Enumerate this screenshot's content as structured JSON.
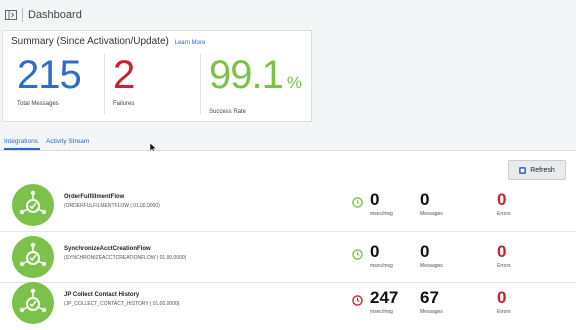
{
  "header": {
    "title": "Dashboard",
    "menu_icon": "panel-toggle-icon"
  },
  "summary": {
    "title": "Summary (Since Activation/Update)",
    "learn_more": "Learn More",
    "total_messages": {
      "value": "215",
      "label": "Total Messages",
      "color": "#2f6cc5"
    },
    "failures": {
      "value": "2",
      "label": "Failures",
      "color": "#cc2030"
    },
    "success_rate": {
      "value": "99.1",
      "unit": "%",
      "label": "Success Rate",
      "color": "#7cc14a"
    }
  },
  "tabs": [
    {
      "label": "Integrations",
      "active": true
    },
    {
      "label": "Activity Stream",
      "active": false
    }
  ],
  "toolbar": {
    "refresh_label": "Refresh",
    "refresh_icon": "refresh-icon"
  },
  "integrations": [
    {
      "name": "OrderFulfillmentFlow",
      "code": "(ORDERFULFILMENTFLOW | 01.00.0000)",
      "time": "0",
      "time_label": "msec/msg",
      "messages": "0",
      "messages_label": "Messages",
      "errors": "0",
      "errors_label": "Errors",
      "clock_color": "#7cc14a"
    },
    {
      "name": "SynchronizeAcctCreationFlow",
      "code": "(SYNCHRONIZEACCTCREATIONFLOW | 01.00.0000)",
      "time": "0",
      "time_label": "msec/msg",
      "messages": "0",
      "messages_label": "Messages",
      "errors": "0",
      "errors_label": "Errors",
      "clock_color": "#7cc14a"
    },
    {
      "name": "JP Collect Contact History",
      "code": "(JP_COLLECT_CONTACT_HISTORY | 01.00.0000)",
      "time": "247",
      "time_label": "msec/msg",
      "messages": "67",
      "messages_label": "Messages",
      "errors": "0",
      "errors_label": "Errors",
      "clock_color": "#cc2030"
    }
  ],
  "colors": {
    "accent": "#2a6ac1",
    "flow_green": "#7cc14a",
    "error_red": "#cc2030"
  }
}
